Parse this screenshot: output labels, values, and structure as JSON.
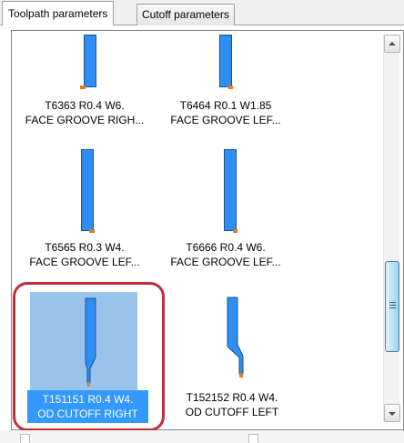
{
  "tabs": [
    {
      "label": "Toolpath parameters",
      "active": true
    },
    {
      "label": "Cutoff parameters",
      "active": false
    }
  ],
  "tools": [
    {
      "line1": "T6363 R0.4 W6.",
      "line2": "FACE GROOVE RIGH...",
      "selected": false
    },
    {
      "line1": "T6464 R0.1 W1.85",
      "line2": "FACE GROOVE LEF...",
      "selected": false
    },
    {
      "line1": "T6565 R0.3 W4.",
      "line2": "FACE GROOVE LEF...",
      "selected": false
    },
    {
      "line1": "T6666 R0.4 W6.",
      "line2": "FACE GROOVE LEF...",
      "selected": false
    },
    {
      "line1": "T151151 R0.4 W4.",
      "line2": "OD CUTOFF RIGHT",
      "selected": true
    },
    {
      "line1": "T152152 R0.4 W4.",
      "line2": "OD CUTOFF LEFT",
      "selected": false
    }
  ],
  "scroll": {
    "position": 0.8
  },
  "colors": {
    "tool_body": "#2f8ff0",
    "tool_insert": "#e07a26",
    "selection": "#3399ff",
    "highlight_ring": "#c0303a"
  },
  "icons": {
    "scroll_up": "chevron-up-icon",
    "scroll_down": "chevron-down-icon"
  }
}
